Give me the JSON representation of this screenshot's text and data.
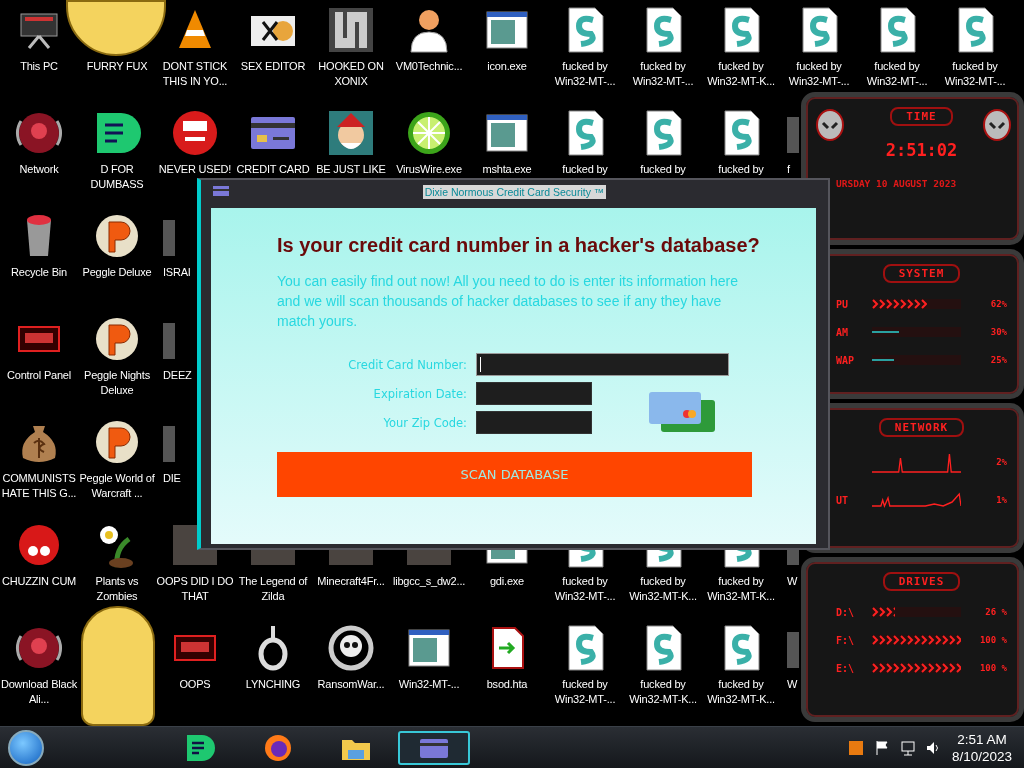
{
  "desktop": {
    "rows": [
      [
        {
          "kind": "pc",
          "label": "This PC"
        },
        {
          "kind": "sticker",
          "label": "FURRY FUX"
        },
        {
          "kind": "cone",
          "label": "DONT STICK THIS IN YO..."
        },
        {
          "kind": "hex",
          "label": "SEX EDITOR"
        },
        {
          "kind": "maze",
          "label": "HOOKED ON XONIX"
        },
        {
          "kind": "person",
          "label": "VM0Technic..."
        },
        {
          "kind": "window",
          "label": "icon.exe"
        },
        {
          "kind": "scroll",
          "label": "fucked by Win32-MT-..."
        },
        {
          "kind": "scroll",
          "label": "fucked by Win32-MT-..."
        },
        {
          "kind": "scroll",
          "label": "fucked by Win32-MT-K..."
        },
        {
          "kind": "scroll",
          "label": "fucked by Win32-MT-..."
        },
        {
          "kind": "scroll",
          "label": "fucked by Win32-MT-..."
        },
        {
          "kind": "scroll",
          "label": "fucked by Win32-MT-..."
        }
      ],
      [
        {
          "kind": "orb",
          "label": "Network"
        },
        {
          "kind": "chat",
          "label": "D FOR DUMBASS"
        },
        {
          "kind": "dev",
          "label": "NEVER USED!"
        },
        {
          "kind": "card",
          "label": "CREDIT CARD"
        },
        {
          "kind": "elf",
          "label": "BE JUST LIKE"
        },
        {
          "kind": "lime",
          "label": "VirusWire.exe"
        },
        {
          "kind": "window",
          "label": "mshta.exe"
        },
        {
          "kind": "scroll",
          "label": "fucked by"
        },
        {
          "kind": "scroll",
          "label": "fucked by"
        },
        {
          "kind": "scroll",
          "label": "fucked by"
        },
        {
          "kind": "partial",
          "label": "f"
        }
      ],
      [
        {
          "kind": "bin",
          "label": "Recycle Bin"
        },
        {
          "kind": "peggle",
          "label": "Peggle Deluxe"
        },
        {
          "kind": "partial",
          "label": "ISRAI"
        }
      ],
      [
        {
          "kind": "panel",
          "label": "Control Panel"
        },
        {
          "kind": "peggle",
          "label": "Peggle Nights Deluxe"
        },
        {
          "kind": "partial",
          "label": "DEEZ"
        }
      ],
      [
        {
          "kind": "money",
          "label": "COMMUNISTS HATE THIS G..."
        },
        {
          "kind": "peggle",
          "label": "Peggle World of Warcraft ..."
        },
        {
          "kind": "partial",
          "label": "DIE"
        }
      ],
      [
        {
          "kind": "fuzzy",
          "label": "CHUZZIN CUM"
        },
        {
          "kind": "plant",
          "label": "Plants vs Zombies"
        },
        {
          "kind": "photo",
          "label": "OOPS DID I DO THAT"
        },
        {
          "kind": "photo",
          "label": "The Legend of Zilda"
        },
        {
          "kind": "photo",
          "label": "Minecraft4Fr..."
        },
        {
          "kind": "photo",
          "label": "libgcc_s_dw2..."
        },
        {
          "kind": "window",
          "label": "gdi.exe"
        },
        {
          "kind": "scroll",
          "label": "fucked by Win32-MT-..."
        },
        {
          "kind": "scroll",
          "label": "fucked by Win32-MT-K..."
        },
        {
          "kind": "scroll",
          "label": "fucked by Win32-MT-K..."
        },
        {
          "kind": "partial",
          "label": "W"
        }
      ],
      [
        {
          "kind": "orb",
          "label": "Download Black Ali..."
        },
        {
          "kind": "sticker"
        },
        {
          "kind": "panel",
          "label": "OOPS"
        },
        {
          "kind": "noose",
          "label": "LYNCHING"
        },
        {
          "kind": "skull",
          "label": "RansomWar..."
        },
        {
          "kind": "window",
          "label": "Win32-MT-..."
        },
        {
          "kind": "file",
          "label": "bsod.hta"
        },
        {
          "kind": "scroll",
          "label": "fucked by Win32-MT-..."
        },
        {
          "kind": "scroll",
          "label": "fucked by Win32-MT-K..."
        },
        {
          "kind": "scroll",
          "label": "fucked by Win32-MT-K..."
        },
        {
          "kind": "partial",
          "label": "W"
        }
      ]
    ]
  },
  "dialog": {
    "title": "Dixie Normous Credit Card Security ™",
    "heading": "Is your credit card number in a hacker's database?",
    "text": "You can easily find out now! All you need to do is enter its information here and we will scan thousands of hacker databases to see if any they have match yours.",
    "fields": [
      {
        "label": "Credit Card Number:",
        "focused": true,
        "kind": "wide"
      },
      {
        "label": "Expiration Date:",
        "focused": false,
        "kind": "short"
      },
      {
        "label": "Your Zip Code:",
        "focused": false,
        "kind": "short"
      }
    ],
    "button": "SCAN DATABASE"
  },
  "gadget": {
    "time": {
      "title": "TIME",
      "clock": "2:51:02",
      "date": "URSDAY 10 AUGUST 2023"
    },
    "system": {
      "title": "SYSTEM",
      "meters": [
        {
          "label": "PU",
          "kind": "chevrons",
          "level": 0.62,
          "reading": "62%"
        },
        {
          "label": "AM",
          "kind": "line",
          "level": 0.3,
          "reading": "30%"
        },
        {
          "label": "WAP",
          "kind": "line",
          "level": 0.25,
          "reading": "25%"
        }
      ]
    },
    "network": {
      "title": "NETWORK",
      "graphs": [
        {
          "reading": "2%"
        },
        {
          "label": "UT",
          "reading": "1%"
        }
      ]
    },
    "drives": {
      "title": "DRIVES",
      "meters": [
        {
          "label": "D:\\",
          "kind": "chevrons",
          "level": 0.26,
          "reading": "26 %"
        },
        {
          "label": "F:\\",
          "kind": "chevrons",
          "level": 1,
          "reading": "100 %"
        },
        {
          "label": "E:\\",
          "kind": "chevrons",
          "level": 1,
          "reading": "100 %"
        }
      ]
    }
  },
  "taskbar": {
    "apps": [
      {
        "kind": "chat",
        "selected": false
      },
      {
        "kind": "firefox",
        "selected": false
      },
      {
        "kind": "folder",
        "selected": false
      },
      {
        "kind": "card",
        "selected": true
      }
    ],
    "clock": {
      "time": "2:51 AM",
      "date": "8/10/2023"
    }
  }
}
